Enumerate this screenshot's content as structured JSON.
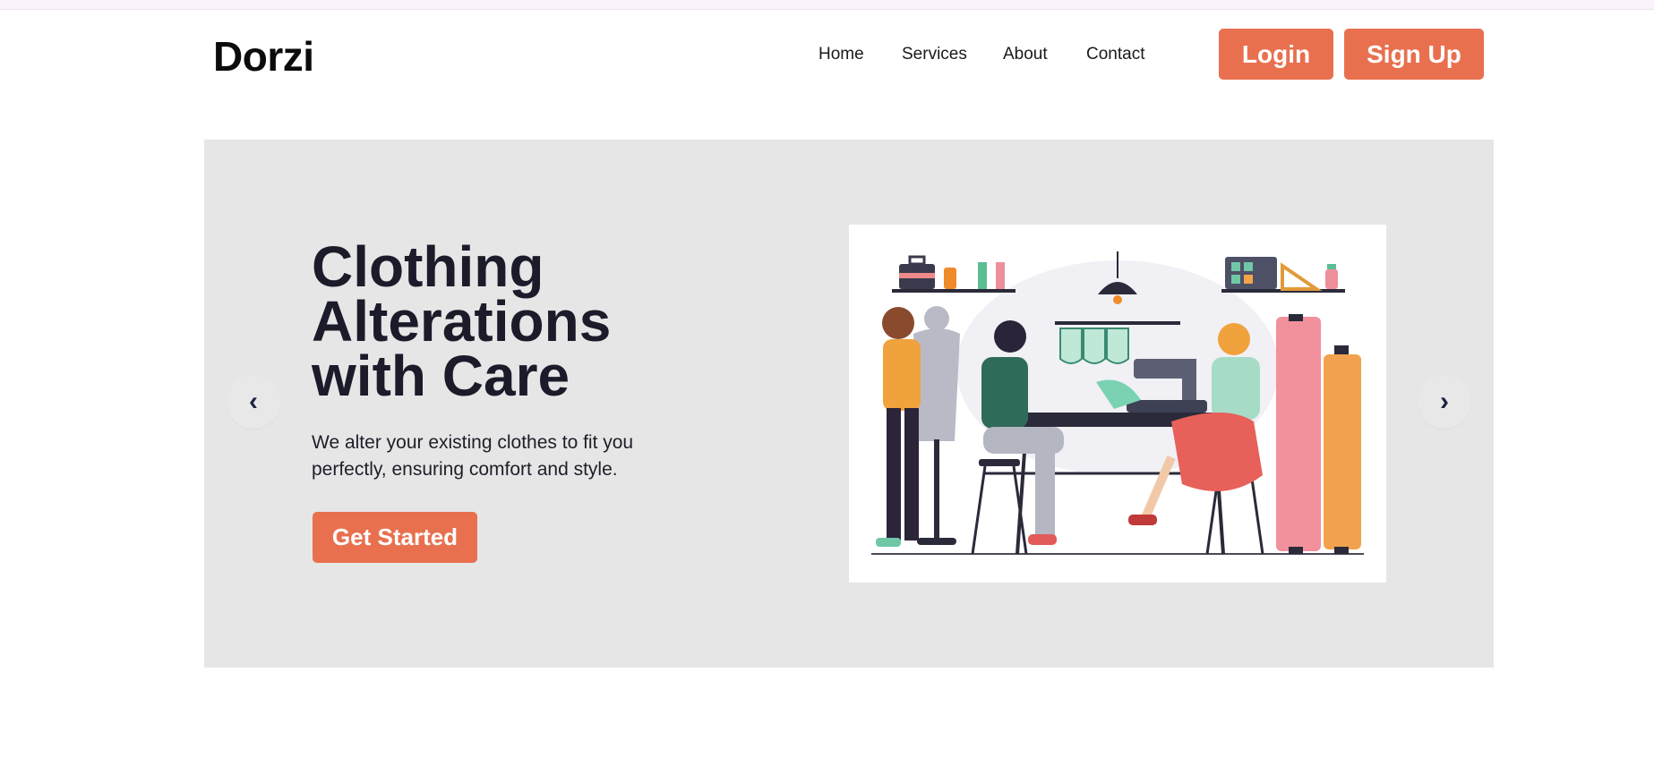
{
  "brand": {
    "logo_text": "Dorzi"
  },
  "nav": {
    "links": [
      {
        "label": "Home"
      },
      {
        "label": "Services"
      },
      {
        "label": "About"
      },
      {
        "label": "Contact"
      }
    ],
    "login_label": "Login",
    "signup_label": "Sign Up"
  },
  "hero": {
    "title_lines": [
      "Clothing",
      "Alterations",
      "with Care"
    ],
    "description": "We alter your existing clothes to fit you perfectly, ensuring comfort and style.",
    "cta_label": "Get Started",
    "prev_arrow": "‹",
    "next_arrow": "›"
  },
  "colors": {
    "accent": "#e8704f",
    "hero_background": "#e6e6e6",
    "heading": "#1b1b2a"
  },
  "icons": {
    "prev": "chevron-left-icon",
    "next": "chevron-right-icon"
  }
}
